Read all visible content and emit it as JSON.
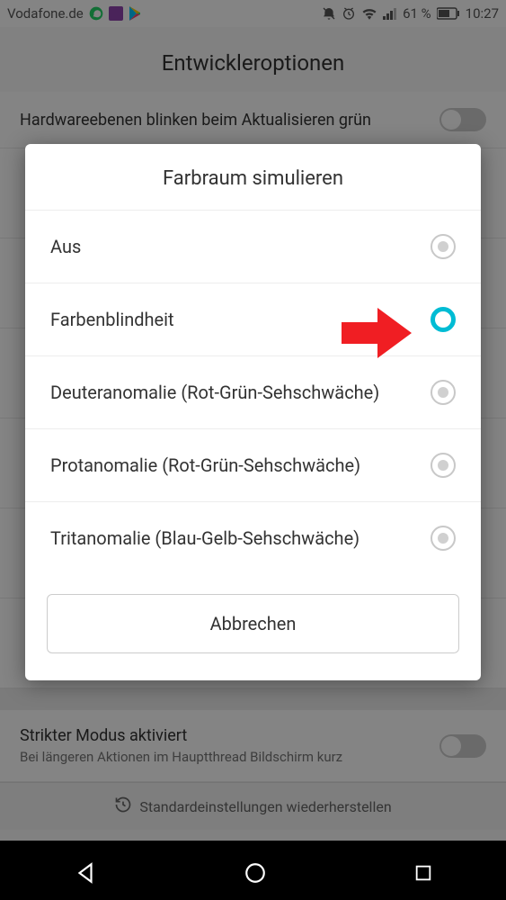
{
  "status_bar": {
    "carrier": "Vodafone.de",
    "battery_pct": "61 %",
    "time": "10:27"
  },
  "page": {
    "title": "Entwickleroptionen",
    "row1": "Hardwareebenen blinken beim Aktualisieren grün",
    "strict_title": "Strikter Modus aktiviert",
    "strict_sub": "Bei längeren Aktionen im Hauptthread Bildschirm kurz",
    "reset": "Standardeinstellungen wiederherstellen"
  },
  "dialog": {
    "title": "Farbraum simulieren",
    "options": [
      {
        "label": "Aus",
        "selected": false
      },
      {
        "label": "Farbenblindheit",
        "selected": true
      },
      {
        "label": "Deuteranomalie (Rot-Grün-Sehschwäche)",
        "selected": false
      },
      {
        "label": "Protanomalie (Rot-Grün-Sehschwäche)",
        "selected": false
      },
      {
        "label": "Tritanomalie (Blau-Gelb-Sehschwäche)",
        "selected": false
      }
    ],
    "cancel": "Abbrechen"
  },
  "colors": {
    "accent": "#00bcd4",
    "arrow": "#f01e23"
  }
}
